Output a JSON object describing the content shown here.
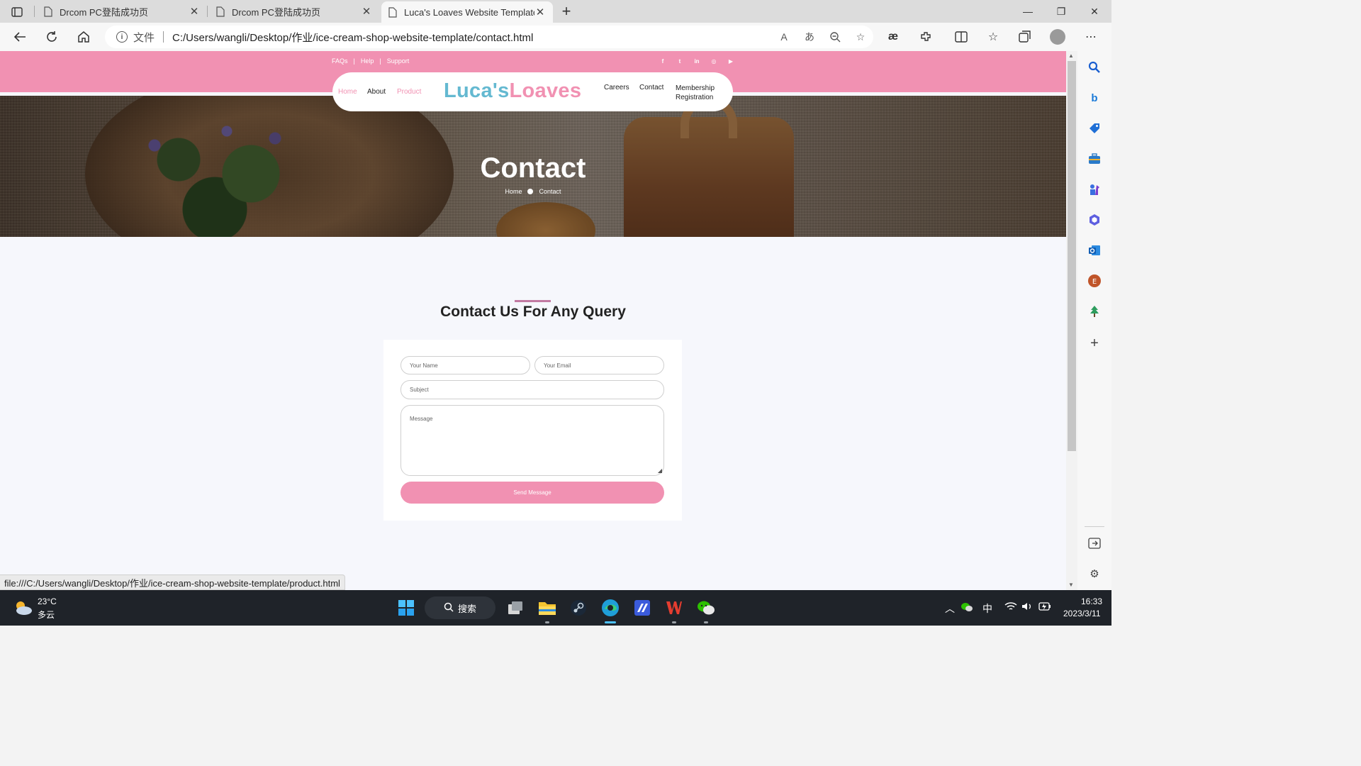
{
  "browser": {
    "tabs": [
      {
        "title": "Drcom PC登陆成功页",
        "active": false
      },
      {
        "title": "Drcom PC登陆成功页",
        "active": false
      },
      {
        "title": "Luca's Loaves Website Template",
        "active": true
      }
    ],
    "close_glyph": "✕",
    "new_tab_glyph": "+",
    "window_controls": {
      "minimize": "—",
      "maximize": "❐",
      "close": "✕"
    },
    "address": {
      "scheme_label": "文件",
      "url": "C:/Users/wangli/Desktop/作业/ice-cream-shop-website-template/contact.html"
    },
    "status_url": "file:///C:/Users/wangli/Desktop/作业/ice-cream-shop-website-template/product.html"
  },
  "site": {
    "toplinks": [
      "FAQs",
      "Help",
      "Support"
    ],
    "toplink_sep": "|",
    "socials": [
      "facebook-icon",
      "twitter-icon",
      "linkedin-icon",
      "instagram-icon",
      "youtube-icon"
    ],
    "social_glyphs": [
      "f",
      "t",
      "in",
      "◎",
      "▶"
    ],
    "nav_left": [
      {
        "label": "Home",
        "active": true
      },
      {
        "label": "About",
        "active": false
      },
      {
        "label": "Product",
        "active": true
      }
    ],
    "logo_part1": "Luca's",
    "logo_part2": "Loaves",
    "nav_right": [
      {
        "label": "Careers"
      },
      {
        "label": "Contact"
      },
      {
        "label": "Membership Registration"
      }
    ],
    "hero": {
      "title": "Contact",
      "crumb_home": "Home",
      "crumb_current": "Contact"
    },
    "section_title": "Contact Us For Any Query",
    "form": {
      "name_placeholder": "Your Name",
      "email_placeholder": "Your Email",
      "subject_placeholder": "Subject",
      "message_placeholder": "Message",
      "submit_label": "Send Message"
    },
    "colors": {
      "brand_pink": "#f191b2",
      "brand_blue": "#64b9d1",
      "accent_bar": "#c27aa2"
    }
  },
  "taskbar": {
    "weather_temp": "23°C",
    "weather_desc": "多云",
    "search_label": "搜索",
    "ime": "中",
    "time": "16:33",
    "date": "2023/3/11"
  }
}
